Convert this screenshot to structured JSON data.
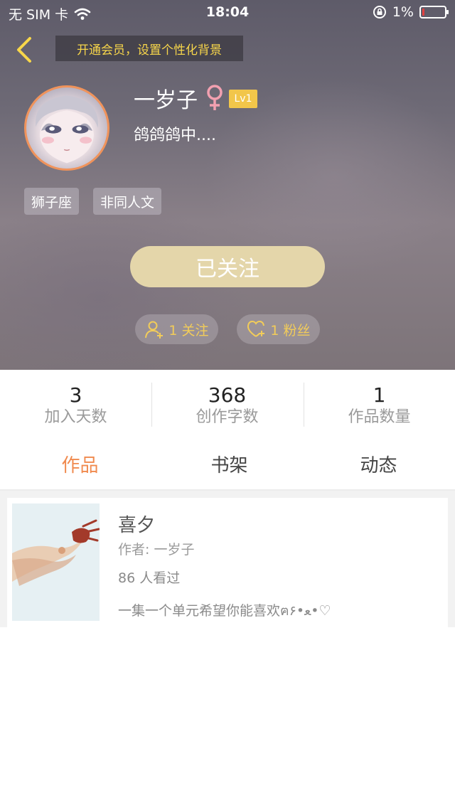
{
  "status_bar": {
    "carrier": "无 SIM 卡",
    "time": "18:04",
    "battery": "1%",
    "battery_level": 0.01,
    "icons": [
      "wifi-icon",
      "rotation-lock-icon",
      "battery-icon"
    ]
  },
  "header": {
    "back_icon": "chevron-left-icon",
    "vip_banner": "开通会员，设置个性化背景"
  },
  "profile": {
    "username": "一岁子",
    "gender_icon": "female-icon",
    "level": "Lv1",
    "bio": "鸽鸽鸽中....",
    "tags": [
      "狮子座",
      "非同人文"
    ],
    "follow_button": "已关注",
    "following": "1 关注",
    "fans": "1 粉丝"
  },
  "stats": [
    {
      "value": "3",
      "label": "加入天数"
    },
    {
      "value": "368",
      "label": "创作字数"
    },
    {
      "value": "1",
      "label": "作品数量"
    }
  ],
  "tabs": [
    "作品",
    "书架",
    "动态"
  ],
  "active_tab": "作品",
  "works": [
    {
      "title": "喜夕",
      "author": "作者: 一岁子",
      "views": "86 人看过",
      "description": "一集一个单元希望你能喜欢ฅ۶•ﻌ•♡"
    }
  ],
  "colors": {
    "accent_orange": "#f08a4e",
    "accent_yellow": "#f2cc59",
    "follow_button": "#e4d6aa",
    "level_badge": "#f2c64a"
  }
}
